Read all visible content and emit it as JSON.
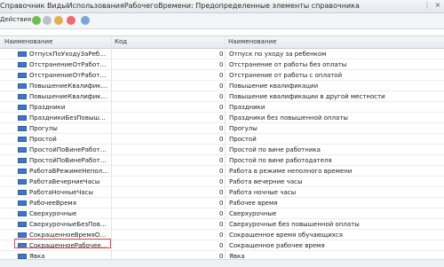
{
  "window": {
    "title": "Справочник ВидыИспользованияРабочегоВремени: Предопределенные элементы справочника"
  },
  "toolbar": {
    "actions_label": "Действия ▾"
  },
  "table": {
    "columns": {
      "name": "Наименование",
      "code": "Код",
      "description": "Наименование"
    },
    "rows": [
      {
        "name": "ОтпускПоУходуЗаРебенком",
        "code": "0",
        "description": "Отпуск по уходу за ребенком"
      },
      {
        "name": "ОтстранениеОтРаботыБ...",
        "code": "0",
        "description": "Отстранение от работы без оплаты"
      },
      {
        "name": "ОтстранениеОтРаботыС...",
        "code": "0",
        "description": "Отстранение от работы с оплатой"
      },
      {
        "name": "ПовышениеКвалификац...",
        "code": "0",
        "description": "Повышение квалификации"
      },
      {
        "name": "ПовышениеКвалификац...",
        "code": "0",
        "description": "Повышение квалификации в другой местности"
      },
      {
        "name": "Праздники",
        "code": "0",
        "description": "Праздники"
      },
      {
        "name": "ПраздникиБезПовышен...",
        "code": "0",
        "description": "Праздники без повышенной оплаты"
      },
      {
        "name": "Прогулы",
        "code": "0",
        "description": "Прогулы"
      },
      {
        "name": "Простой",
        "code": "0",
        "description": "Простой"
      },
      {
        "name": "ПростойПоВинеРаботн...",
        "code": "0",
        "description": "Простой по вине работника"
      },
      {
        "name": "ПростойПоВинеРабото...",
        "code": "0",
        "description": "Простой по вине работодателя"
      },
      {
        "name": "РаботаВРежимеНеполн...",
        "code": "0",
        "description": "Работа в режиме неполного времени"
      },
      {
        "name": "РаботаВечерниеЧасы",
        "code": "0",
        "description": "Работа вечерние часы"
      },
      {
        "name": "РаботаНочныеЧасы",
        "code": "0",
        "description": "Работа ночные часы"
      },
      {
        "name": "РабочееВремя",
        "code": "0",
        "description": "Рабочее время"
      },
      {
        "name": "Сверхурочные",
        "code": "0",
        "description": "Сверхурочные"
      },
      {
        "name": "СверхурочныеБезПовы...",
        "code": "0",
        "description": "Сверхурочные без повышенной оплаты"
      },
      {
        "name": "СокращенноеВремяОбу...",
        "code": "0",
        "description": "Сокращенное время обучающихся"
      },
      {
        "name": "СокращенноеРабочееВ...",
        "code": "0",
        "description": "Сокращенное рабочее время"
      },
      {
        "name": "Явка",
        "code": "0",
        "description": "Явка"
      }
    ]
  },
  "colors": {
    "highlight_border": "#d94b4b",
    "row_icon": "#3b78c6"
  }
}
